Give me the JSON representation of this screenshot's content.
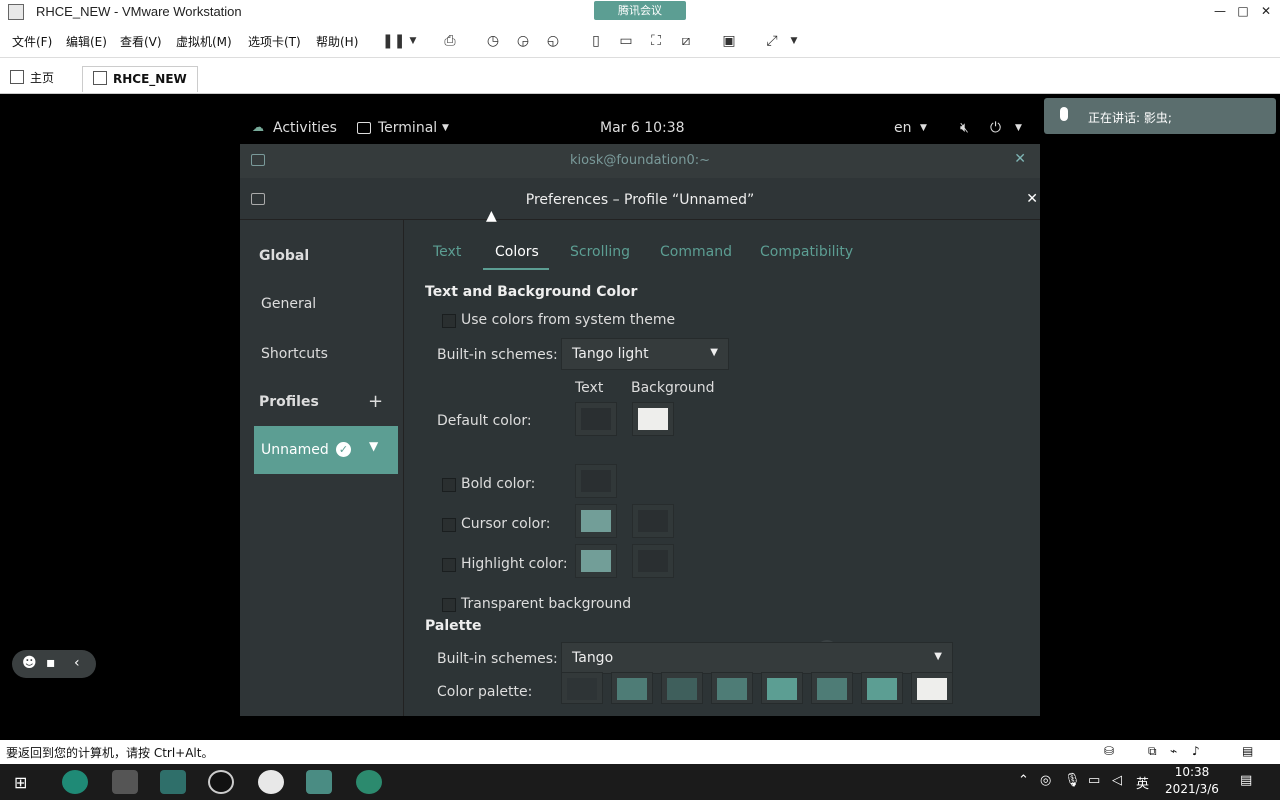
{
  "vmware": {
    "title": "RHCE_NEW - VMware Workstation",
    "meeting_badge": "腾讯会议",
    "menus": [
      "文件(F)",
      "编辑(E)",
      "查看(V)",
      "虚拟机(M)",
      "选项卡(T)",
      "帮助(H)"
    ],
    "tabs": {
      "home": "主页",
      "vm": "RHCE_NEW"
    },
    "status_message": "要返回到您的计算机，请按 Ctrl+Alt。"
  },
  "gnome": {
    "activities": "Activities",
    "app_menu": "Terminal",
    "clock": "Mar 6  10:38",
    "language": "en"
  },
  "terminal": {
    "title": "kiosk@foundation0:~"
  },
  "preferences": {
    "title": "Preferences – Profile “Unnamed”",
    "sidebar": {
      "global_heading": "Global",
      "general": "General",
      "shortcuts": "Shortcuts",
      "profiles_heading": "Profiles",
      "add": "+",
      "profile_name": "Unnamed"
    },
    "tabs": [
      "Text",
      "Colors",
      "Scrolling",
      "Command",
      "Compatibility"
    ],
    "active_tab": "Colors",
    "text_bg": {
      "heading": "Text and Background Color",
      "use_system": "Use colors from system theme",
      "builtin_label": "Built-in schemes:",
      "builtin_value": "Tango light",
      "col_text": "Text",
      "col_background": "Background",
      "default_color": "Default color:",
      "bold_color": "Bold color:",
      "cursor_color": "Cursor color:",
      "highlight_color": "Highlight color:",
      "transparent": "Transparent background"
    },
    "palette": {
      "heading": "Palette",
      "builtin_label": "Built-in schemes:",
      "builtin_value": "Tango",
      "color_palette_label": "Color palette:"
    }
  },
  "colors": {
    "accent": "#5c9e93",
    "window_bg": "#2d3436",
    "swatch_dark": "#2a2f31",
    "swatch_light": "#eeeeec",
    "swatch_teal": "#84b9b1",
    "palette": [
      "#2e3436",
      "#4e7c76",
      "#3f5f5c",
      "#4e7c76",
      "#5c9e93",
      "#4e7c76",
      "#5c9e93",
      "#eeeeec"
    ]
  },
  "meeting": {
    "speaking": "正在讲话: 影虫;"
  },
  "taskbar": {
    "time": "10:38",
    "date": "2021/3/6",
    "ime": "英"
  }
}
